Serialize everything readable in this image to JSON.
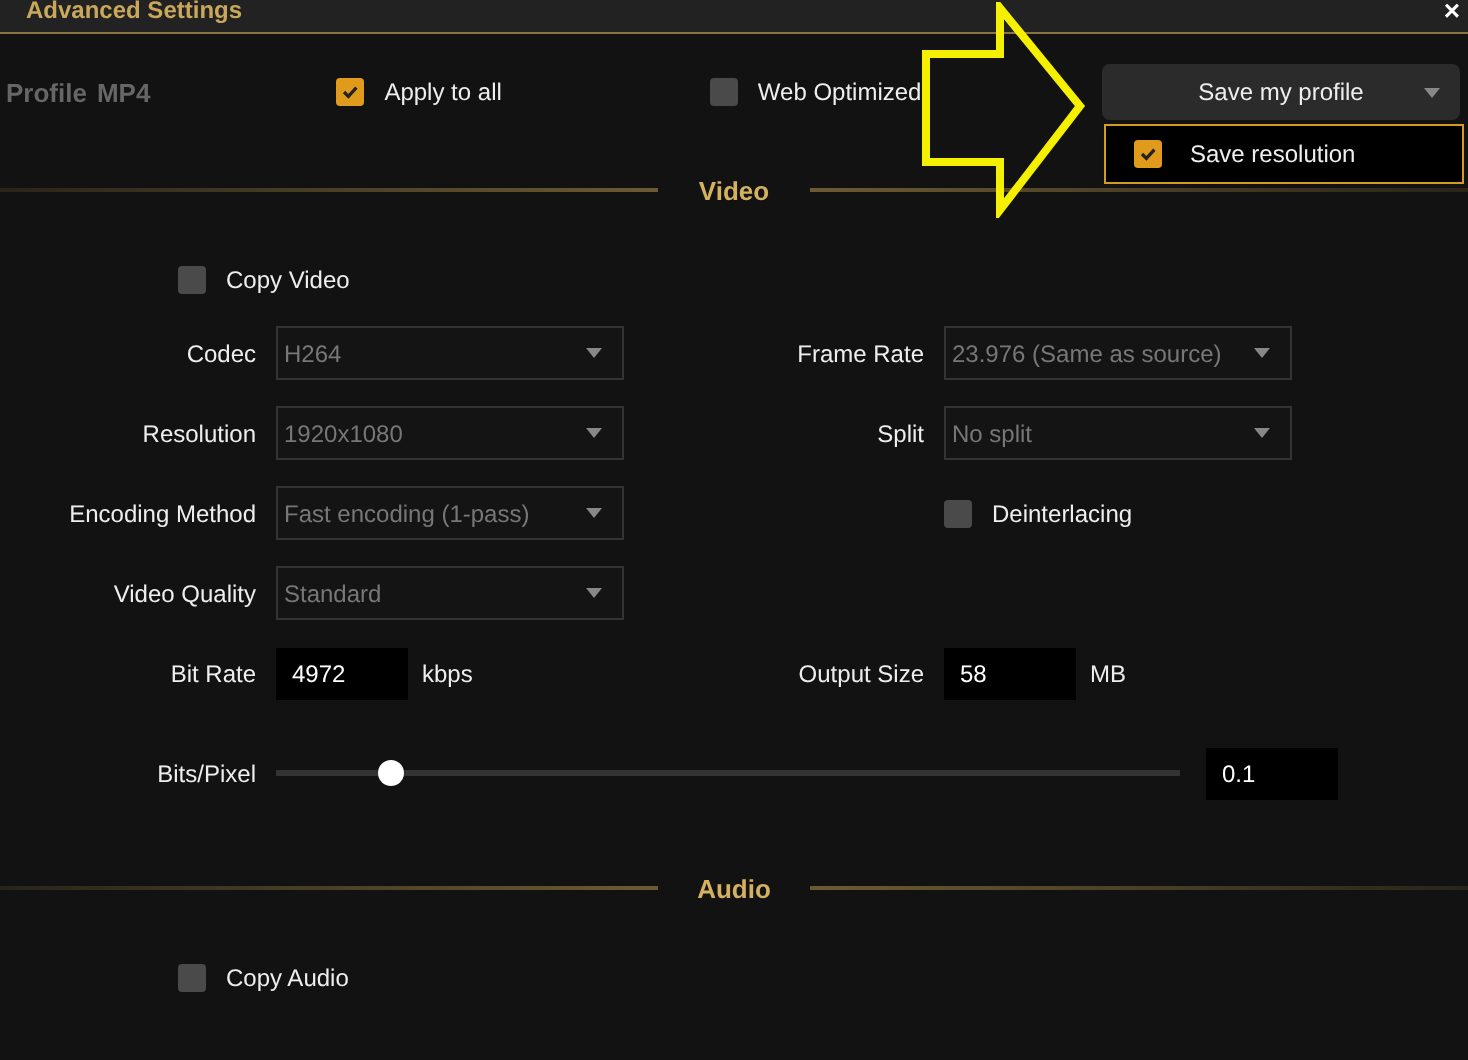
{
  "window": {
    "title": "Advanced Settings",
    "close": "×"
  },
  "header": {
    "profile_label": "Profile",
    "profile_value": "MP4",
    "apply_to_all": {
      "label": "Apply to all",
      "checked": true
    },
    "web_optimized": {
      "label": "Web Optimized",
      "checked": false
    },
    "save_button": "Save my profile",
    "save_menu": {
      "label": "Save resolution",
      "checked": true
    }
  },
  "video": {
    "title": "Video",
    "copy": {
      "label": "Copy Video",
      "checked": false
    },
    "rows": [
      {
        "left": {
          "kind": "dropdown",
          "label": "Codec",
          "value": "H264"
        },
        "right": {
          "kind": "dropdown",
          "label": "Frame Rate",
          "value": "23.976 (Same as source)"
        }
      },
      {
        "left": {
          "kind": "dropdown",
          "label": "Resolution",
          "value": "1920x1080"
        },
        "right": {
          "kind": "dropdown",
          "label": "Split",
          "value": "No split"
        }
      },
      {
        "left": {
          "kind": "dropdown",
          "label": "Encoding Method",
          "value": "Fast encoding (1-pass)"
        },
        "right": {
          "kind": "checkbox",
          "label": "Deinterlacing",
          "checked": false
        }
      },
      {
        "left": {
          "kind": "dropdown",
          "label": "Video Quality",
          "value": "Standard"
        }
      },
      {
        "left": {
          "kind": "number",
          "label": "Bit Rate",
          "value": "4972",
          "unit": "kbps"
        },
        "right": {
          "kind": "number",
          "label": "Output Size",
          "value": "58",
          "unit": "MB"
        }
      }
    ],
    "slider": {
      "label": "Bits/Pixel",
      "level": 0.126,
      "value": "0.1"
    }
  },
  "audio": {
    "title": "Audio",
    "copy": {
      "label": "Copy Audio",
      "checked": false
    }
  }
}
